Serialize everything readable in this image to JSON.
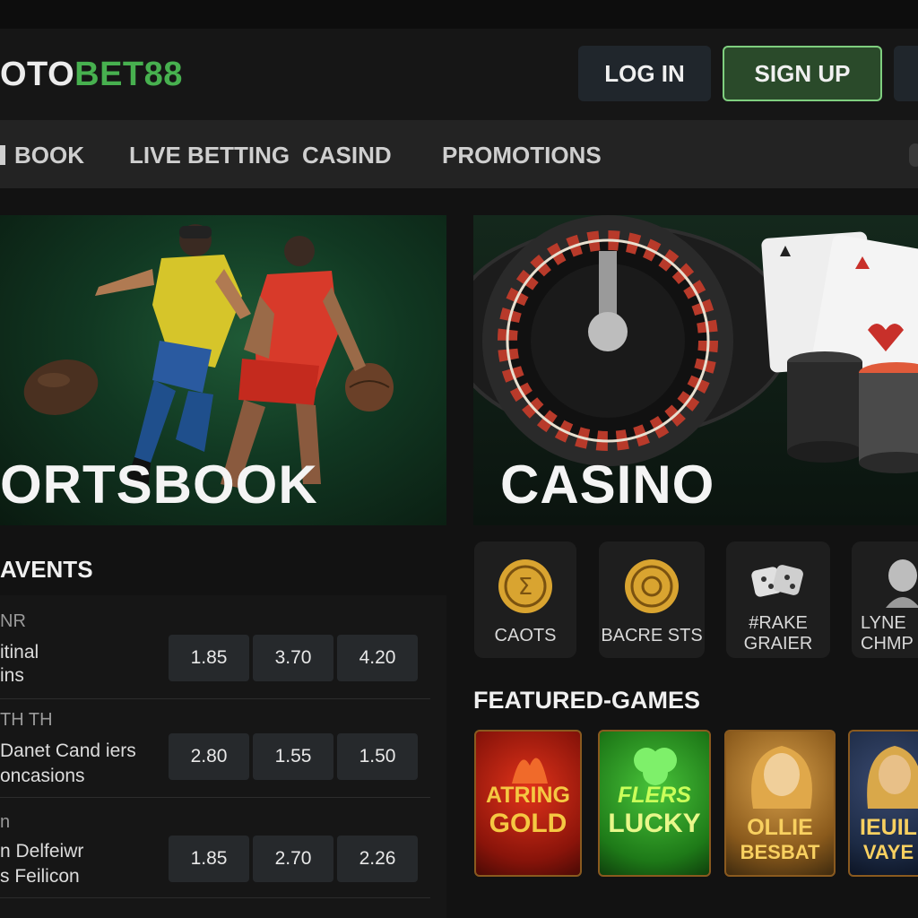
{
  "brand": {
    "logo_part1": "OTO",
    "logo_part2": "BET88"
  },
  "auth": {
    "login_label": "LOG IN",
    "signup_label": "SIGN UP"
  },
  "nav": {
    "items": [
      "BOOK",
      "LIVE BETTING",
      "CASIND",
      "PROMOTIONS"
    ]
  },
  "banners": {
    "sports_title": "ORTSBOOK",
    "casino_title": "CASINO"
  },
  "events": {
    "heading": "AVENTS",
    "rows": [
      {
        "league": "NR",
        "team1": "itinal",
        "team2": "ins",
        "odds": [
          "1.85",
          "3.70",
          "4.20"
        ]
      },
      {
        "league": "TH TH",
        "team1": "Danet Cand iers",
        "team2": "oncasions",
        "odds": [
          "2.80",
          "1.55",
          "1.50"
        ]
      },
      {
        "league": "n",
        "team1": "n Delfeiwr",
        "team2": "s Feilicon",
        "odds": [
          "1.85",
          "2.70",
          "2.26"
        ]
      }
    ]
  },
  "casino_categories": [
    {
      "label1": "CAOTS",
      "label2": "",
      "icon": "coin-icon"
    },
    {
      "label1": "BACRE STS",
      "label2": "",
      "icon": "coin-icon"
    },
    {
      "label1": "#RAKE",
      "label2": "GRAIER",
      "icon": "dice-icon"
    },
    {
      "label1": "LYNE",
      "label2": "CHMP",
      "icon": "dealer-icon"
    }
  ],
  "featured": {
    "heading": "FEATURED-GAMES",
    "games": [
      {
        "line1": "ATRING",
        "line2": "GOLD"
      },
      {
        "line1": "FLERS",
        "line2": "LUCKY"
      },
      {
        "line1": "OLLIE",
        "line2": "BESBAT"
      },
      {
        "line1": "IEUIL",
        "line2": "VAYE"
      }
    ]
  },
  "colors": {
    "brand_green": "#47b04f",
    "signup_border": "#7fcf7f",
    "background": "#121212"
  }
}
